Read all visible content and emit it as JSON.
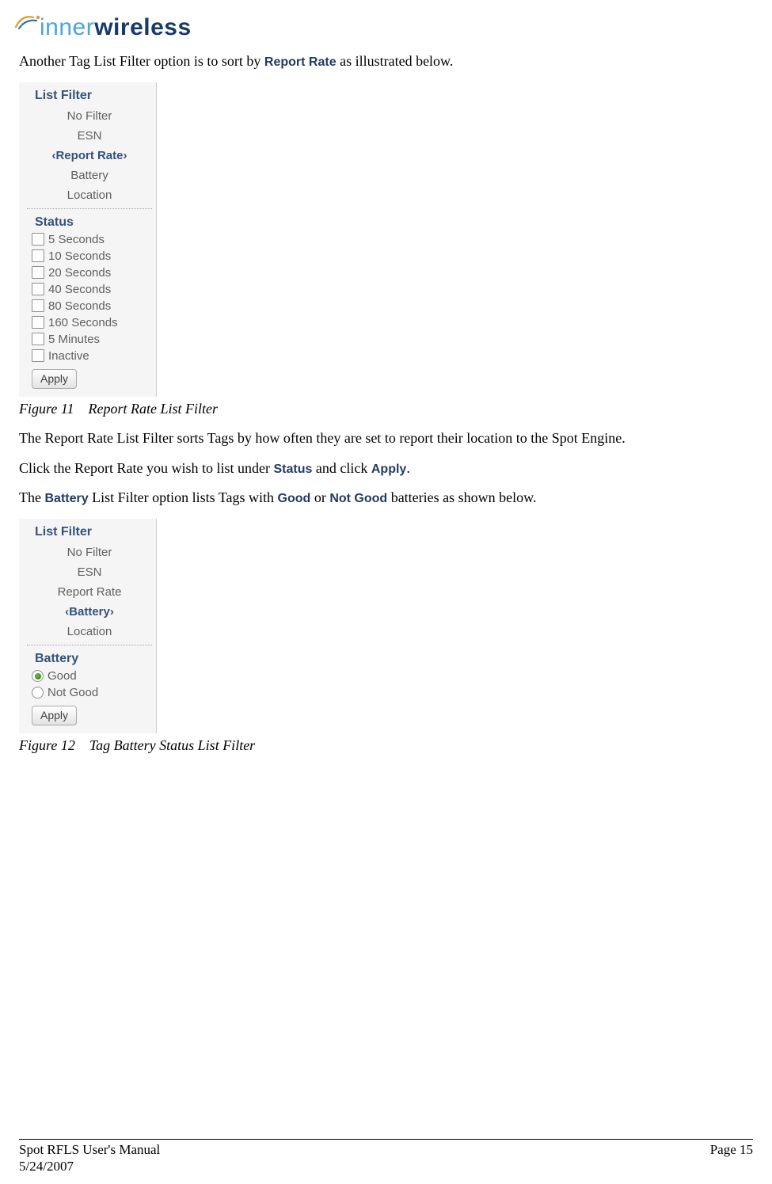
{
  "logo": {
    "text_inner": "inner",
    "text_wireless": "wireless"
  },
  "intro_1a": "Another Tag List Filter option is to sort by ",
  "intro_1b": "Report Rate",
  "intro_1c": " as illustrated below.",
  "panel1": {
    "title": "List Filter",
    "filters": [
      "No Filter",
      "ESN",
      "‹Report Rate›",
      "Battery",
      "Location"
    ],
    "selected_index": 2,
    "subtitle": "Status",
    "options": [
      "5 Seconds",
      "10 Seconds",
      "20 Seconds",
      "40 Seconds",
      "80 Seconds",
      "160 Seconds",
      "5 Minutes",
      "Inactive"
    ],
    "apply": "Apply"
  },
  "caption1_a": "Figure 11",
  "caption1_b": "Report Rate List Filter",
  "para2": "The Report Rate List Filter sorts Tags by how often they are set to report their location to the Spot Engine.",
  "para3_a": "Click the Report Rate you wish to list under ",
  "para3_b": "Status",
  "para3_c": " and click ",
  "para3_d": "Apply",
  "para3_e": ".",
  "para4_a": "The ",
  "para4_b": "Battery",
  "para4_c": " List Filter option lists Tags with ",
  "para4_d": "Good",
  "para4_e": " or ",
  "para4_f": "Not Good",
  "para4_g": " batteries as shown below.",
  "panel2": {
    "title": "List Filter",
    "filters": [
      "No Filter",
      "ESN",
      "Report Rate",
      "‹Battery›",
      "Location"
    ],
    "selected_index": 3,
    "subtitle": "Battery",
    "options": [
      "Good",
      "Not Good"
    ],
    "selected_radio": 0,
    "apply": "Apply"
  },
  "caption2_a": "Figure 12",
  "caption2_b": "Tag Battery Status List Filter",
  "footer": {
    "left_line1": "Spot RFLS User's Manual",
    "left_line2": "5/24/2007",
    "right": "Page 15"
  }
}
